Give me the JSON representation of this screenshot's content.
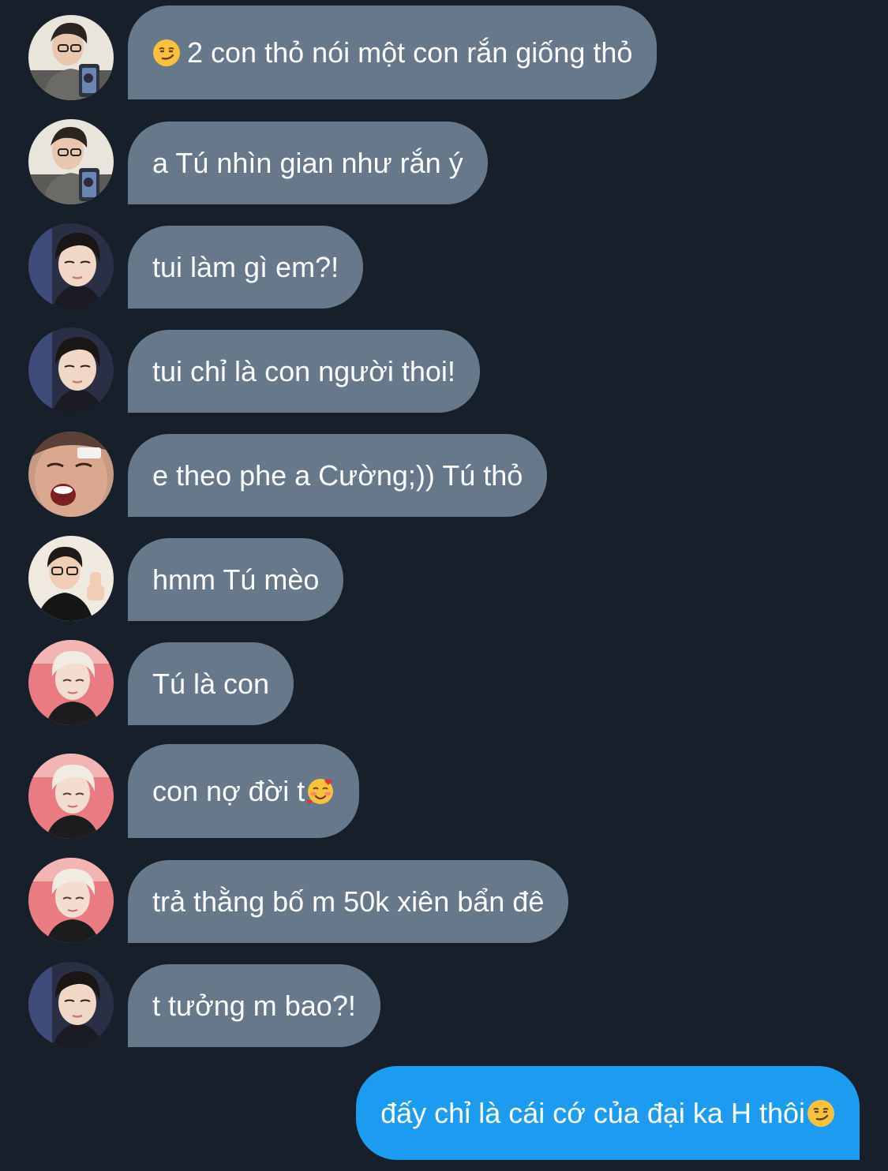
{
  "messages": [
    {
      "avatar": "avatar-glasses-phone",
      "emoji_before": "smirk-emoji-icon",
      "text": "2 con thỏ nói một con rắn giống thỏ"
    },
    {
      "avatar": "avatar-glasses-phone",
      "text": "a Tú nhìn gian như rắn ý"
    },
    {
      "avatar": "avatar-dark-hair",
      "text": "tui làm gì em?!"
    },
    {
      "avatar": "avatar-dark-hair",
      "text": "tui chỉ là con người thoi!"
    },
    {
      "avatar": "avatar-surprised",
      "text": "e theo phe a Cường;)) Tú thỏ"
    },
    {
      "avatar": "avatar-thumbs-up",
      "text": "hmm Tú mèo"
    },
    {
      "avatar": "avatar-blond-pink",
      "text": "Tú là con"
    },
    {
      "avatar": "avatar-blond-pink",
      "text": "con nợ đời t",
      "emoji_after": "smiling-hearts-emoji-icon"
    },
    {
      "avatar": "avatar-blond-pink",
      "text": "trả thằng bố m 50k xiên bẩn đê"
    },
    {
      "avatar": "avatar-dark-hair",
      "text": "t tưởng m bao?!"
    },
    {
      "outgoing": true,
      "text": "đấy chỉ là cái cớ của đại ka H thôi",
      "emoji_after": "smirk-emoji-icon"
    }
  ],
  "colors": {
    "background": "#17202a",
    "incoming_bubble": "#66788a",
    "outgoing_bubble": "#1d9bf0",
    "text": "#ffffff"
  }
}
